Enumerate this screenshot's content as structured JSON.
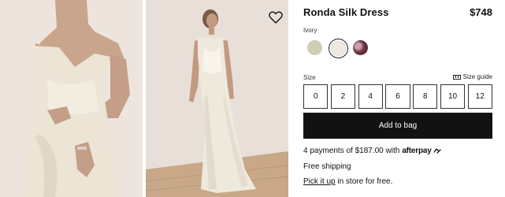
{
  "product": {
    "title": "Ronda Silk Dress",
    "price": "$748"
  },
  "color": {
    "selected_label": "Ivory",
    "swatches": [
      {
        "name": "sage",
        "color": "#cfcdb3"
      },
      {
        "name": "ivory",
        "color": "#efe9df",
        "selected": true
      },
      {
        "name": "plum floral",
        "color": "#6b3342"
      }
    ]
  },
  "size": {
    "label": "Size",
    "guide_label": "Size guide",
    "options": [
      "0",
      "2",
      "4",
      "6",
      "8",
      "10",
      "12"
    ]
  },
  "cart": {
    "add_label": "Add to bag"
  },
  "payment": {
    "installments_text": "4 payments of $187.00 with",
    "provider": "afterpay"
  },
  "shipping": {
    "text": "Free shipping"
  },
  "pickup": {
    "link_text": "Pick it up",
    "rest_text": " in store for free."
  },
  "icons": {
    "wishlist": "heart-icon",
    "size_guide": "ruler-icon",
    "afterpay": "afterpay-loop-icon"
  },
  "colors": {
    "button_bg": "#121212",
    "photo_bg": "#e9dfd7"
  }
}
